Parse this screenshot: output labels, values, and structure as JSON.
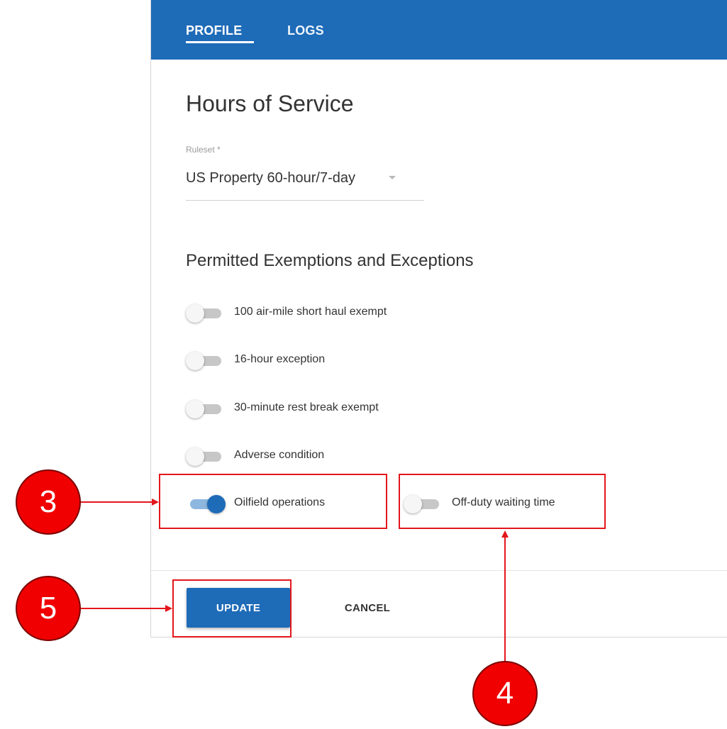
{
  "tabs": [
    {
      "label": "PROFILE",
      "active": true
    },
    {
      "label": "LOGS",
      "active": false
    }
  ],
  "page_title": "Hours of Service",
  "ruleset": {
    "label": "Ruleset *",
    "value": "US Property 60-hour/7-day"
  },
  "exemptions_title": "Permitted Exemptions and Exceptions",
  "toggles": [
    {
      "label": "100 air-mile short haul exempt",
      "on": false
    },
    {
      "label": "16-hour exception",
      "on": false
    },
    {
      "label": "30-minute rest break exempt",
      "on": false
    },
    {
      "label": "Adverse condition",
      "on": false
    },
    {
      "label": "Oilfield operations",
      "on": true
    },
    {
      "label": "Off-duty waiting time",
      "on": false
    }
  ],
  "actions": {
    "update_label": "UPDATE",
    "cancel_label": "CANCEL"
  },
  "callouts": [
    "3",
    "4",
    "5"
  ],
  "colors": {
    "primary": "#1e6bb8",
    "callout": "#f00000",
    "highlight": "#e3161c"
  }
}
